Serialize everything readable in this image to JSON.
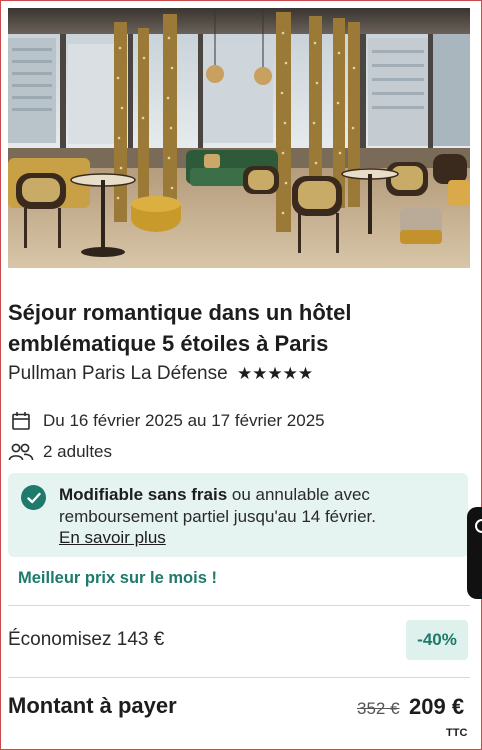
{
  "hero": {
    "image_alt": "hotel-lounge-photo"
  },
  "offer": {
    "title": "Séjour romantique dans un hôtel emblématique 5 étoiles à Paris",
    "hotel_name": "Pullman Paris La Défense",
    "stars": "★★★★★",
    "star_count": 5
  },
  "stay": {
    "dates": "Du 16 février 2025 au 17 février 2025",
    "guests": "2 adultes",
    "icons": {
      "dates": "calendar-icon",
      "guests": "people-icon"
    }
  },
  "cancellation": {
    "bold": "Modifiable sans frais",
    "rest": " ou annulable avec remboursement partiel jusqu'au 14 février.",
    "link": "En savoir plus",
    "icon": "checkmark-icon"
  },
  "best_price": "Meilleur prix sur le mois !",
  "pricing": {
    "savings": "Économisez 143 €",
    "discount": "-40%",
    "total_label": "Montant à payer",
    "old_price": "352 €",
    "new_price": "209 €",
    "tax_note": "TTC"
  },
  "colors": {
    "accent": "#1e7a6b",
    "notice_bg": "#e6f4f1",
    "discount_bg": "#dff1ec",
    "frame": "#c9494d"
  }
}
